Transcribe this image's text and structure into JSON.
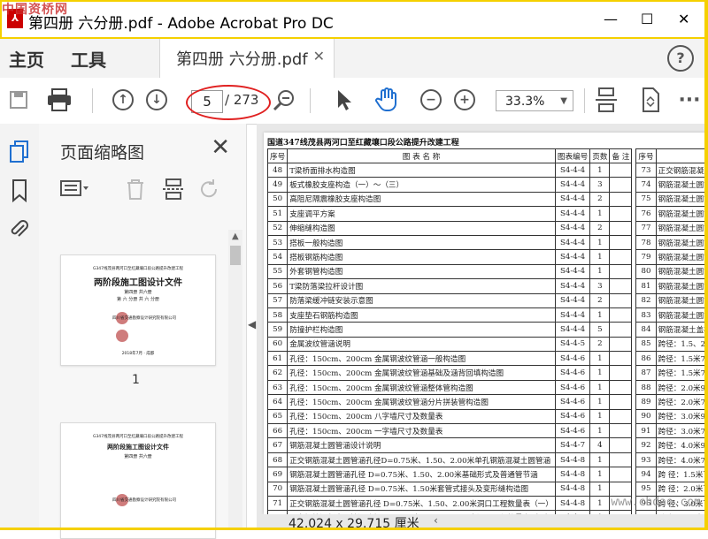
{
  "window": {
    "watermark": "中国资桥网",
    "title": "第四册 六分册.pdf - Adobe Acrobat Pro DC",
    "min": "—",
    "max": "☐",
    "close": "✕"
  },
  "menu": {
    "home": "主页",
    "tools": "工具",
    "help": "?"
  },
  "tab": {
    "label": "第四册 六分册.pdf",
    "close": "✕"
  },
  "toolbar": {
    "page_current": "5",
    "page_total": "/ 273",
    "zoom": "33.3%",
    "zoom_caret": "▼",
    "more": "···"
  },
  "panel": {
    "title": "页面缩略图",
    "close": "✕",
    "thumb1_number": "1",
    "thumb1": {
      "line1": "G347线茂县两河口至红藏壤口段公路提升改建工程",
      "heading": "两阶段施工图设计文件",
      "line2": "第四册 共六册",
      "line3": "第 六 分册 共 六 分册",
      "org1": "四川省交通勘察设计研究院有限公司",
      "date": "2018年7月 · 成都"
    },
    "thumb2": {
      "line1": "G347线茂县两河口至红藏壤口段公路提升改建工程",
      "heading": "两阶段施工图设计文件",
      "line2": "第四册 共六册",
      "org1": "四川省交通勘察设计研究院有限公司"
    }
  },
  "document": {
    "header": "国道347线茂县两河口至红藏壤口段公路提升改建工程",
    "columns_left": [
      "序号",
      "图 表 名 称",
      "图表编号",
      "页数",
      "备 注"
    ],
    "columns_right": [
      "序号",
      "图 表 名"
    ],
    "rows_left": [
      [
        "48",
        "T梁桥面排水构造图",
        "S4-4-4",
        "1"
      ],
      [
        "49",
        "板式橡胶支座构造（一）～（三）",
        "S4-4-4",
        "3"
      ],
      [
        "50",
        "高阻尼隔震橡胶支座构造图",
        "S4-4-4",
        "2"
      ],
      [
        "51",
        "支座调平方案",
        "S4-4-4",
        "1"
      ],
      [
        "52",
        "伸缩缝构造图",
        "S4-4-4",
        "2"
      ],
      [
        "53",
        "搭板一般构造图",
        "S4-4-4",
        "1"
      ],
      [
        "54",
        "搭板钢筋构造图",
        "S4-4-4",
        "1"
      ],
      [
        "55",
        "外套钢管构造图",
        "S4-4-4",
        "1"
      ],
      [
        "56",
        "T梁防落梁拉杆设计图",
        "S4-4-4",
        "3"
      ],
      [
        "57",
        "防落梁缓冲链安装示意图",
        "S4-4-4",
        "2"
      ],
      [
        "58",
        "支座垫石钢筋构造图",
        "S4-4-4",
        "1"
      ],
      [
        "59",
        "防撞护栏构造图",
        "S4-4-4",
        "5"
      ],
      [
        "60",
        "金属波纹管涵说明",
        "S4-4-5",
        "2"
      ],
      [
        "61",
        "孔径：150cm、200cm 金属钢波纹管涵一般构造图",
        "S4-4-6",
        "1"
      ],
      [
        "62",
        "孔径：150cm、200cm 金属钢波纹管涵基础及涵背回填构造图",
        "S4-4-6",
        "1"
      ],
      [
        "63",
        "孔径：150cm、200cm 金属钢波纹管涵整体管构造图",
        "S4-4-6",
        "1"
      ],
      [
        "64",
        "孔径：150cm、200cm 金属钢波纹管涵分片拼装管构造图",
        "S4-4-6",
        "1"
      ],
      [
        "65",
        "孔径：150cm、200cm 八字墙尺寸及数量表",
        "S4-4-6",
        "1"
      ],
      [
        "66",
        "孔径：150cm、200cm 一字墙尺寸及数量表",
        "S4-4-6",
        "1"
      ],
      [
        "67",
        "钢筋混凝土圆管涵设计说明",
        "S4-4-7",
        "4"
      ],
      [
        "68",
        "正交钢筋混凝土圆管涵孔径D=0.75米、1.50、2.00米单孔钢筋混凝土圆管涵",
        "S4-4-8",
        "1"
      ],
      [
        "69",
        "钢筋混凝土圆管涵孔径 D=0.75米、1.50、2.00米基础形式及普通管节涵",
        "S4-4-8",
        "1"
      ],
      [
        "70",
        "钢筋混凝土圆管涵孔径 D=0.75米、1.50米套管式接头及变形缝构造图",
        "S4-4-8",
        "1"
      ],
      [
        "71",
        "正交钢筋混凝土圆管涵孔径 D=0.75米、1.50、2.00米洞口工程数量表（一）",
        "S4-4-8",
        "1"
      ],
      [
        "72",
        "正交钢筋混凝土圆管涵孔径 D=0.75米、1.50、2.00米洞口工程数量表（二）",
        "S4-4-8",
        "1"
      ]
    ],
    "rows_right": [
      [
        "73",
        "正交钢筋混凝土圆管涵孔径 D=0.75米"
      ],
      [
        "74",
        "钢筋混凝土圆管涵孔径0.75米直管节"
      ],
      [
        "75",
        "钢筋混凝土圆管涵孔径0.75米斜管节"
      ],
      [
        "76",
        "钢筋混凝土圆管涵孔径1.50米直管节"
      ],
      [
        "77",
        "钢筋混凝土圆管涵孔径1.50米直管节"
      ],
      [
        "78",
        "钢筋混凝土圆管涵孔径1.50米斜管节"
      ],
      [
        "79",
        "钢筋混凝土圆管涵孔径2.00米直管节"
      ],
      [
        "80",
        "钢筋混凝土圆管涵孔径2.01米直管节"
      ],
      [
        "81",
        "钢筋混凝土圆管涵孔径2.00米斜管节"
      ],
      [
        "82",
        "钢筋混凝土圆管涵孔径2.00米斜管节钢筋"
      ],
      [
        "83",
        "钢筋混凝土圆管涵孔径D=0.75米、1"
      ],
      [
        "84",
        "钢筋混凝土盖板涵设计说明"
      ],
      [
        "85",
        "跨径：1.5、2.0、3.0、4.0米一般构"
      ],
      [
        "86",
        "跨径：1.5米74cm宽盖板钢筋构造图"
      ],
      [
        "87",
        "跨径：1.5米74cm宽盖板钢筋构造图"
      ],
      [
        "88",
        "跨径：2.0米99cm宽盖板钢筋构造图"
      ],
      [
        "89",
        "跨径：2.0米74cm宽盖板钢筋构造图"
      ],
      [
        "90",
        "跨径：3.0米99cm宽盖板钢筋构造图"
      ],
      [
        "91",
        "跨径：3.0米74cm宽盖板钢筋构造图"
      ],
      [
        "92",
        "跨径：4.0米99cm宽盖板钢筋构造图"
      ],
      [
        "93",
        "跨径：4.0米74cm宽盖板钢筋构造图"
      ],
      [
        "94",
        "跨 径：1.5米下部构造尺寸表(L0="
      ],
      [
        "95",
        "跨 径：2.0米下部构造尺寸表(L0="
      ],
      [
        "96",
        "跨 径：3.0米下部构造尺寸表(L0="
      ],
      [
        "97",
        "跨 径：4.0米下部构造尺寸表(L0="
      ]
    ],
    "page_size": "42.024 x 29.715 厘米",
    "site_watermark": "www.chdao.com"
  }
}
